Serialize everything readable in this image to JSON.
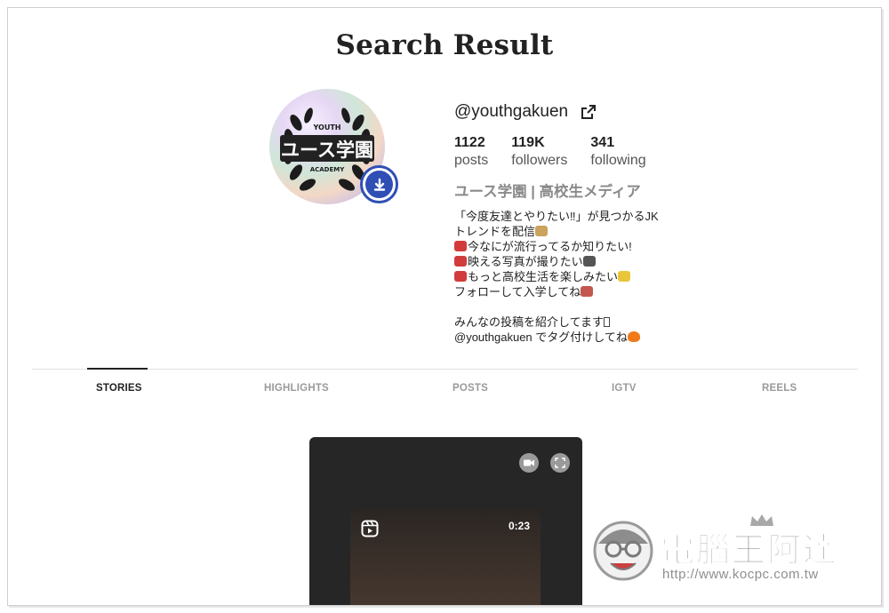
{
  "page": {
    "title": "Search Result"
  },
  "profile": {
    "handle": "@youthgakuen",
    "avatar_text": "ユース学園",
    "avatar_top_text": "YOUTH",
    "avatar_bottom_text": "ACADEMY",
    "stats": [
      {
        "value": "1122",
        "label": "posts"
      },
      {
        "value": "119K",
        "label": "followers"
      },
      {
        "value": "341",
        "label": "following"
      }
    ],
    "full_name": "ユース学園 | 高校生メディア",
    "bio_lines": [
      "「今度友達とやりたい‼︎」が見つかるJK",
      "トレンドを配信",
      "今なにが流行ってるか知りたい!",
      "映える写真が撮りたい",
      "もっと高校生活を楽しみたい",
      "フォローして入学してね",
      "",
      "みんなの投稿を紹介してます",
      "@youthgakuen でタグ付けしてね"
    ]
  },
  "tabs": [
    {
      "label": "STORIES",
      "active": true
    },
    {
      "label": "HIGHLIGHTS",
      "active": false
    },
    {
      "label": "POSTS",
      "active": false
    },
    {
      "label": "IGTV",
      "active": false
    },
    {
      "label": "REELS",
      "active": false
    }
  ],
  "story": {
    "duration": "0:23"
  },
  "watermark": {
    "title": "電腦王阿達",
    "url": "http://www.kocpc.com.tw"
  },
  "colors": {
    "accent": "#2f4fb5",
    "story_bg": "#262626",
    "muted": "#9a9a9a"
  },
  "icons": [
    "external-link-icon",
    "download-icon",
    "video-camera-icon",
    "fullscreen-icon",
    "reels-icon"
  ]
}
